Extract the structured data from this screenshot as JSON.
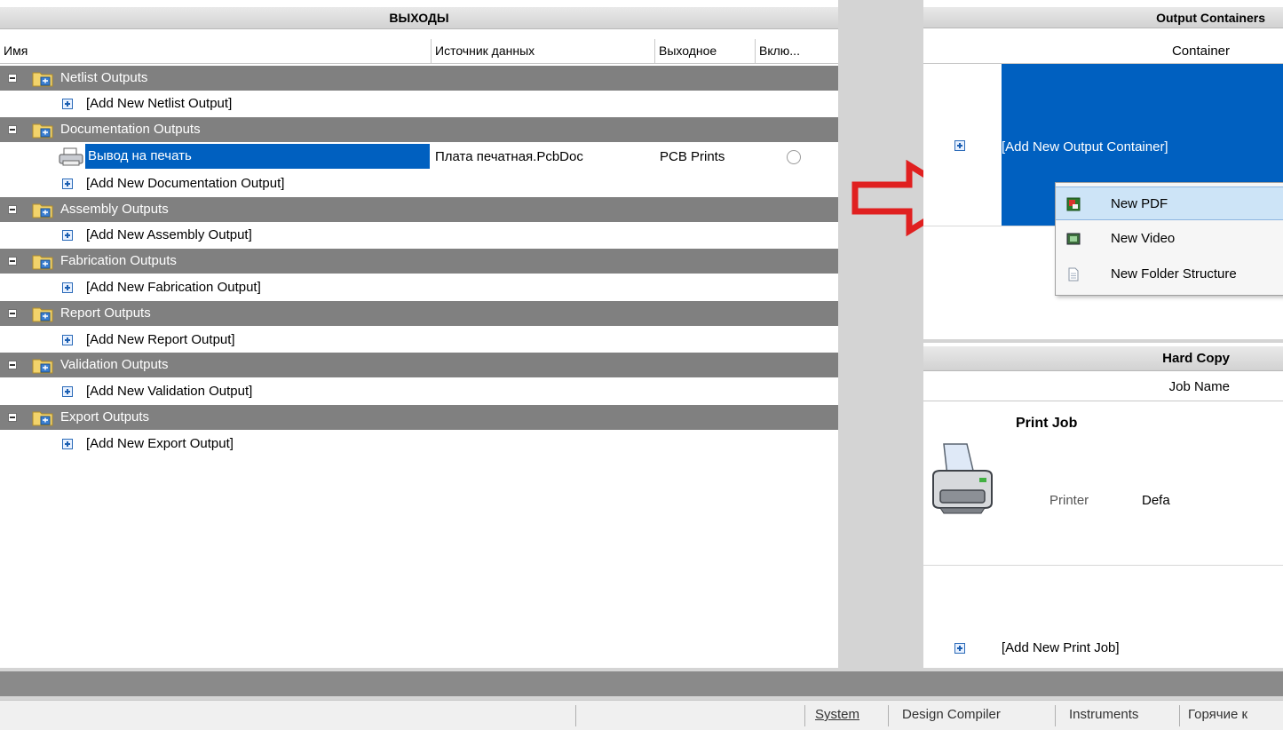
{
  "left": {
    "title": "ВЫХОДЫ",
    "columns": [
      "Имя",
      "Источник данных",
      "Выходное",
      "Вклю..."
    ],
    "groups": [
      {
        "label": "Netlist Outputs",
        "add": "[Add New Netlist Output]"
      },
      {
        "label": "Documentation Outputs",
        "add": "[Add New Documentation Output]",
        "item": {
          "name": "Вывод на печать",
          "source": "Плата печатная.PcbDoc",
          "output": "PCB Prints"
        }
      },
      {
        "label": "Assembly Outputs",
        "add": "[Add New Assembly Output]"
      },
      {
        "label": "Fabrication Outputs",
        "add": "[Add New Fabrication Output]"
      },
      {
        "label": "Report Outputs",
        "add": "[Add New Report Output]"
      },
      {
        "label": "Validation Outputs",
        "add": "[Add New Validation Output]"
      },
      {
        "label": "Export Outputs",
        "add": "[Add New Export Output]"
      }
    ]
  },
  "containers": {
    "title": "Output Containers",
    "column": "Container",
    "add": "[Add New Output Container]",
    "menu": [
      "New PDF",
      "New Video",
      "New Folder Structure"
    ]
  },
  "hardcopy": {
    "title": "Hard Copy",
    "column": "Job Name",
    "job": "Print Job",
    "printer_label": "Printer",
    "printer_value": "Defa",
    "add": "[Add New Print Job]"
  },
  "status_tabs": [
    "System",
    "Design Compiler",
    "Instruments",
    "Горячие к"
  ],
  "colors": {
    "group_bg": "#808080",
    "selection": "#0060c0",
    "arrow": "#e02020",
    "menu_highlight": "#cde4f7"
  }
}
